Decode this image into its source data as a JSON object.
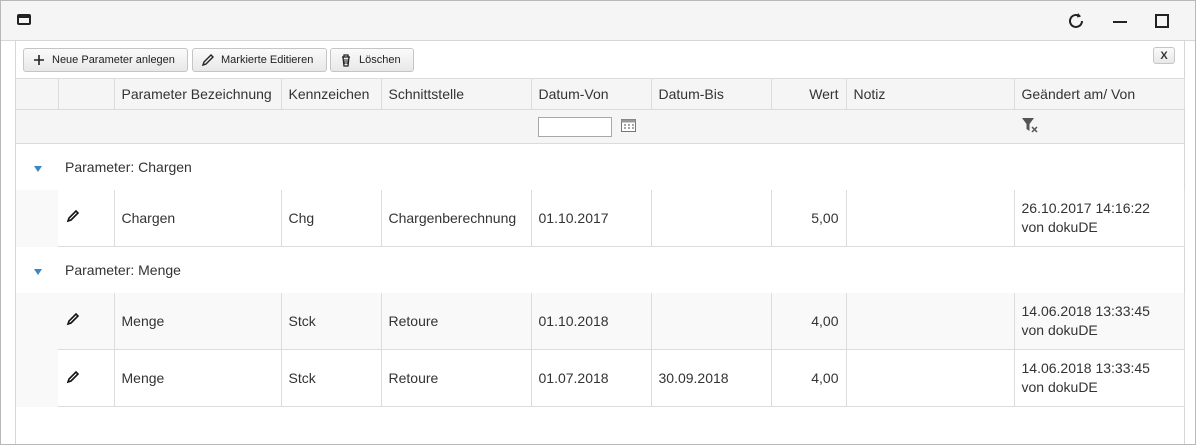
{
  "toolbar": {
    "new_label": "Neue Parameter anlegen",
    "edit_label": "Markierte Editieren",
    "delete_label": "Löschen",
    "close_label": "X"
  },
  "columns": {
    "bezeichnung": "Parameter Bezeichnung",
    "kennzeichen": "Kennzeichen",
    "schnittstelle": "Schnittstelle",
    "datum_von": "Datum-Von",
    "datum_bis": "Datum-Bis",
    "wert": "Wert",
    "notiz": "Notiz",
    "geaendert": "Geändert am/ Von"
  },
  "groups": [
    {
      "label": "Parameter: Chargen",
      "rows": [
        {
          "bezeichnung": "Chargen",
          "kennzeichen": "Chg",
          "schnittstelle": "Chargenberechnung",
          "datum_von": "01.10.2017",
          "datum_bis": "",
          "wert": "5,00",
          "notiz": "",
          "geaendert_am": "26.10.2017 14:16:22",
          "geaendert_von": "von dokuDE"
        }
      ]
    },
    {
      "label": "Parameter: Menge",
      "rows": [
        {
          "bezeichnung": "Menge",
          "kennzeichen": "Stck",
          "schnittstelle": "Retoure",
          "datum_von": "01.10.2018",
          "datum_bis": "",
          "wert": "4,00",
          "notiz": "",
          "geaendert_am": "14.06.2018 13:33:45",
          "geaendert_von": "von dokuDE"
        },
        {
          "bezeichnung": "Menge",
          "kennzeichen": "Stck",
          "schnittstelle": "Retoure",
          "datum_von": "01.07.2018",
          "datum_bis": "30.09.2018",
          "wert": "4,00",
          "notiz": "",
          "geaendert_am": "14.06.2018 13:33:45",
          "geaendert_von": "von dokuDE"
        }
      ]
    }
  ],
  "filter": {
    "datum_von_value": ""
  },
  "colors": {
    "accent": "#3a87c4",
    "header_bg": "#f5f5f5",
    "border": "#dcdcdc"
  }
}
